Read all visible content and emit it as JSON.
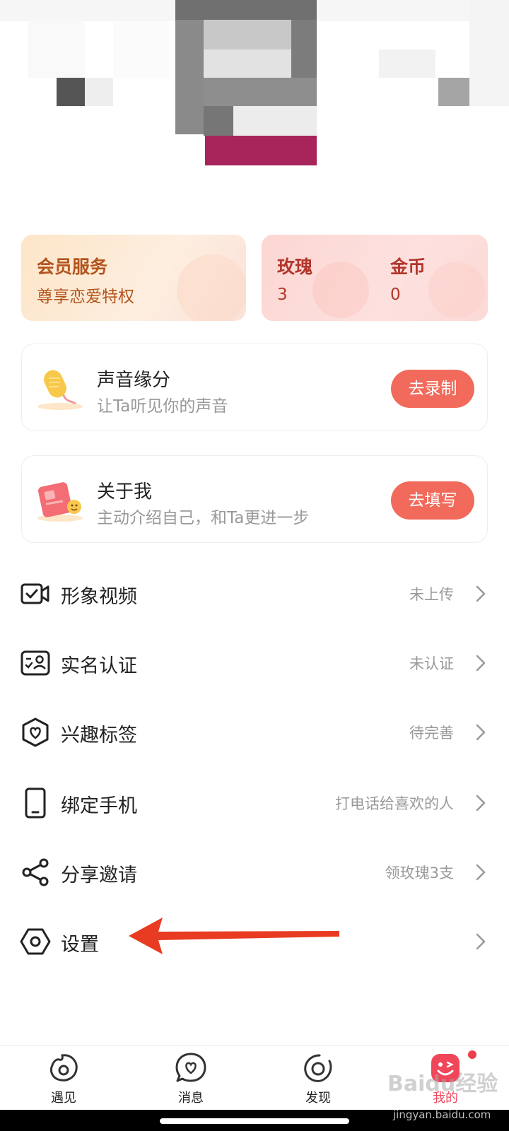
{
  "vip_card": {
    "title": "会员服务",
    "subtitle": "尊享恋爱特权"
  },
  "wallet": {
    "roses_label": "玫瑰",
    "roses_value": "3",
    "coins_label": "金币",
    "coins_value": "0"
  },
  "feature_cards": [
    {
      "title": "声音缘分",
      "subtitle": "让Ta听见你的声音",
      "button": "去录制"
    },
    {
      "title": "关于我",
      "subtitle": "主动介绍自己，和Ta更进一步",
      "button": "去填写"
    }
  ],
  "menu": [
    {
      "label": "形象视频",
      "value": "未上传",
      "icon": "video-check-icon"
    },
    {
      "label": "实名认证",
      "value": "未认证",
      "icon": "id-card-icon"
    },
    {
      "label": "兴趣标签",
      "value": "待完善",
      "icon": "heart-shield-icon"
    },
    {
      "label": "绑定手机",
      "value": "打电话给喜欢的人",
      "icon": "phone-icon"
    },
    {
      "label": "分享邀请",
      "value": "领玫瑰3支",
      "icon": "share-icon"
    },
    {
      "label": "设置",
      "value": "",
      "icon": "settings-hexagon-icon"
    }
  ],
  "bottom_nav": [
    {
      "label": "遇见",
      "icon": "meet-icon"
    },
    {
      "label": "消息",
      "icon": "message-icon"
    },
    {
      "label": "发现",
      "icon": "discover-icon"
    },
    {
      "label": "我的",
      "icon": "me-icon"
    }
  ],
  "watermark": {
    "text": "Baidu经验",
    "url_text": "jingyan.baidu.com"
  },
  "colors": {
    "accent": "#f16a5b",
    "vip_text": "#b4541d",
    "wallet_text": "#b2362b",
    "annotation_arrow": "#e83b21",
    "nav_active": "#f0465a"
  }
}
